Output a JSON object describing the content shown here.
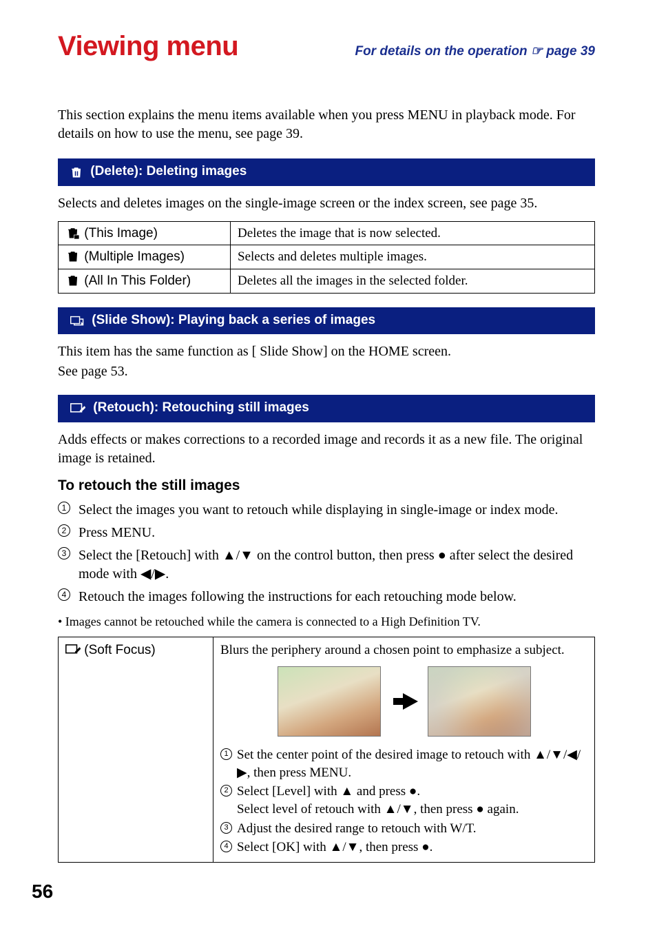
{
  "header": {
    "title": "Viewing menu",
    "details_text": "For details on the operation ☞ page 39"
  },
  "intro": "This section explains the menu items available when you press MENU in playback mode. For details on how to use the menu, see page 39.",
  "delete_section": {
    "bar_title": " (Delete): Deleting images",
    "desc": "Selects and deletes images on the single-image screen or the index screen, see page 35.",
    "options": [
      {
        "label": " (This Image)",
        "desc": "Deletes the image that is now selected."
      },
      {
        "label": " (Multiple Images)",
        "desc": "Selects and deletes multiple images."
      },
      {
        "label": " (All In This Folder)",
        "desc": "Deletes all the images in the selected folder."
      }
    ]
  },
  "slideshow_section": {
    "bar_title": " (Slide Show): Playing back a series of images",
    "line1": "This item has the same function as [     Slide Show] on the HOME screen.",
    "line2": "See page 53."
  },
  "retouch_section": {
    "bar_title": " (Retouch): Retouching still images",
    "desc": "Adds effects or makes corrections to a recorded image and records it as a new file. The original image is retained.",
    "sub_heading": "To retouch the still images",
    "steps": [
      "Select the images you want to retouch while displaying in single-image or index mode.",
      "Press MENU.",
      "Select the [Retouch] with ▲/▼ on the control button, then press ● after select the desired mode with ◀/▶.",
      "Retouch the images following the instructions for each retouching mode below."
    ],
    "note": "• Images cannot be retouched while the camera is connected to a High Definition TV.",
    "mode": {
      "label": " (Soft Focus)",
      "summary": "Blurs the periphery around a chosen point to emphasize a subject.",
      "inner_steps": [
        "Set the center point of the desired image to retouch with ▲/▼/◀/▶, then press MENU.",
        "Select [Level] with ▲ and press ●.\nSelect level of retouch with ▲/▼, then press ● again.",
        "Adjust the desired range to retouch with W/T.",
        "Select [OK] with ▲/▼, then press ●."
      ]
    }
  },
  "page_number": "56"
}
